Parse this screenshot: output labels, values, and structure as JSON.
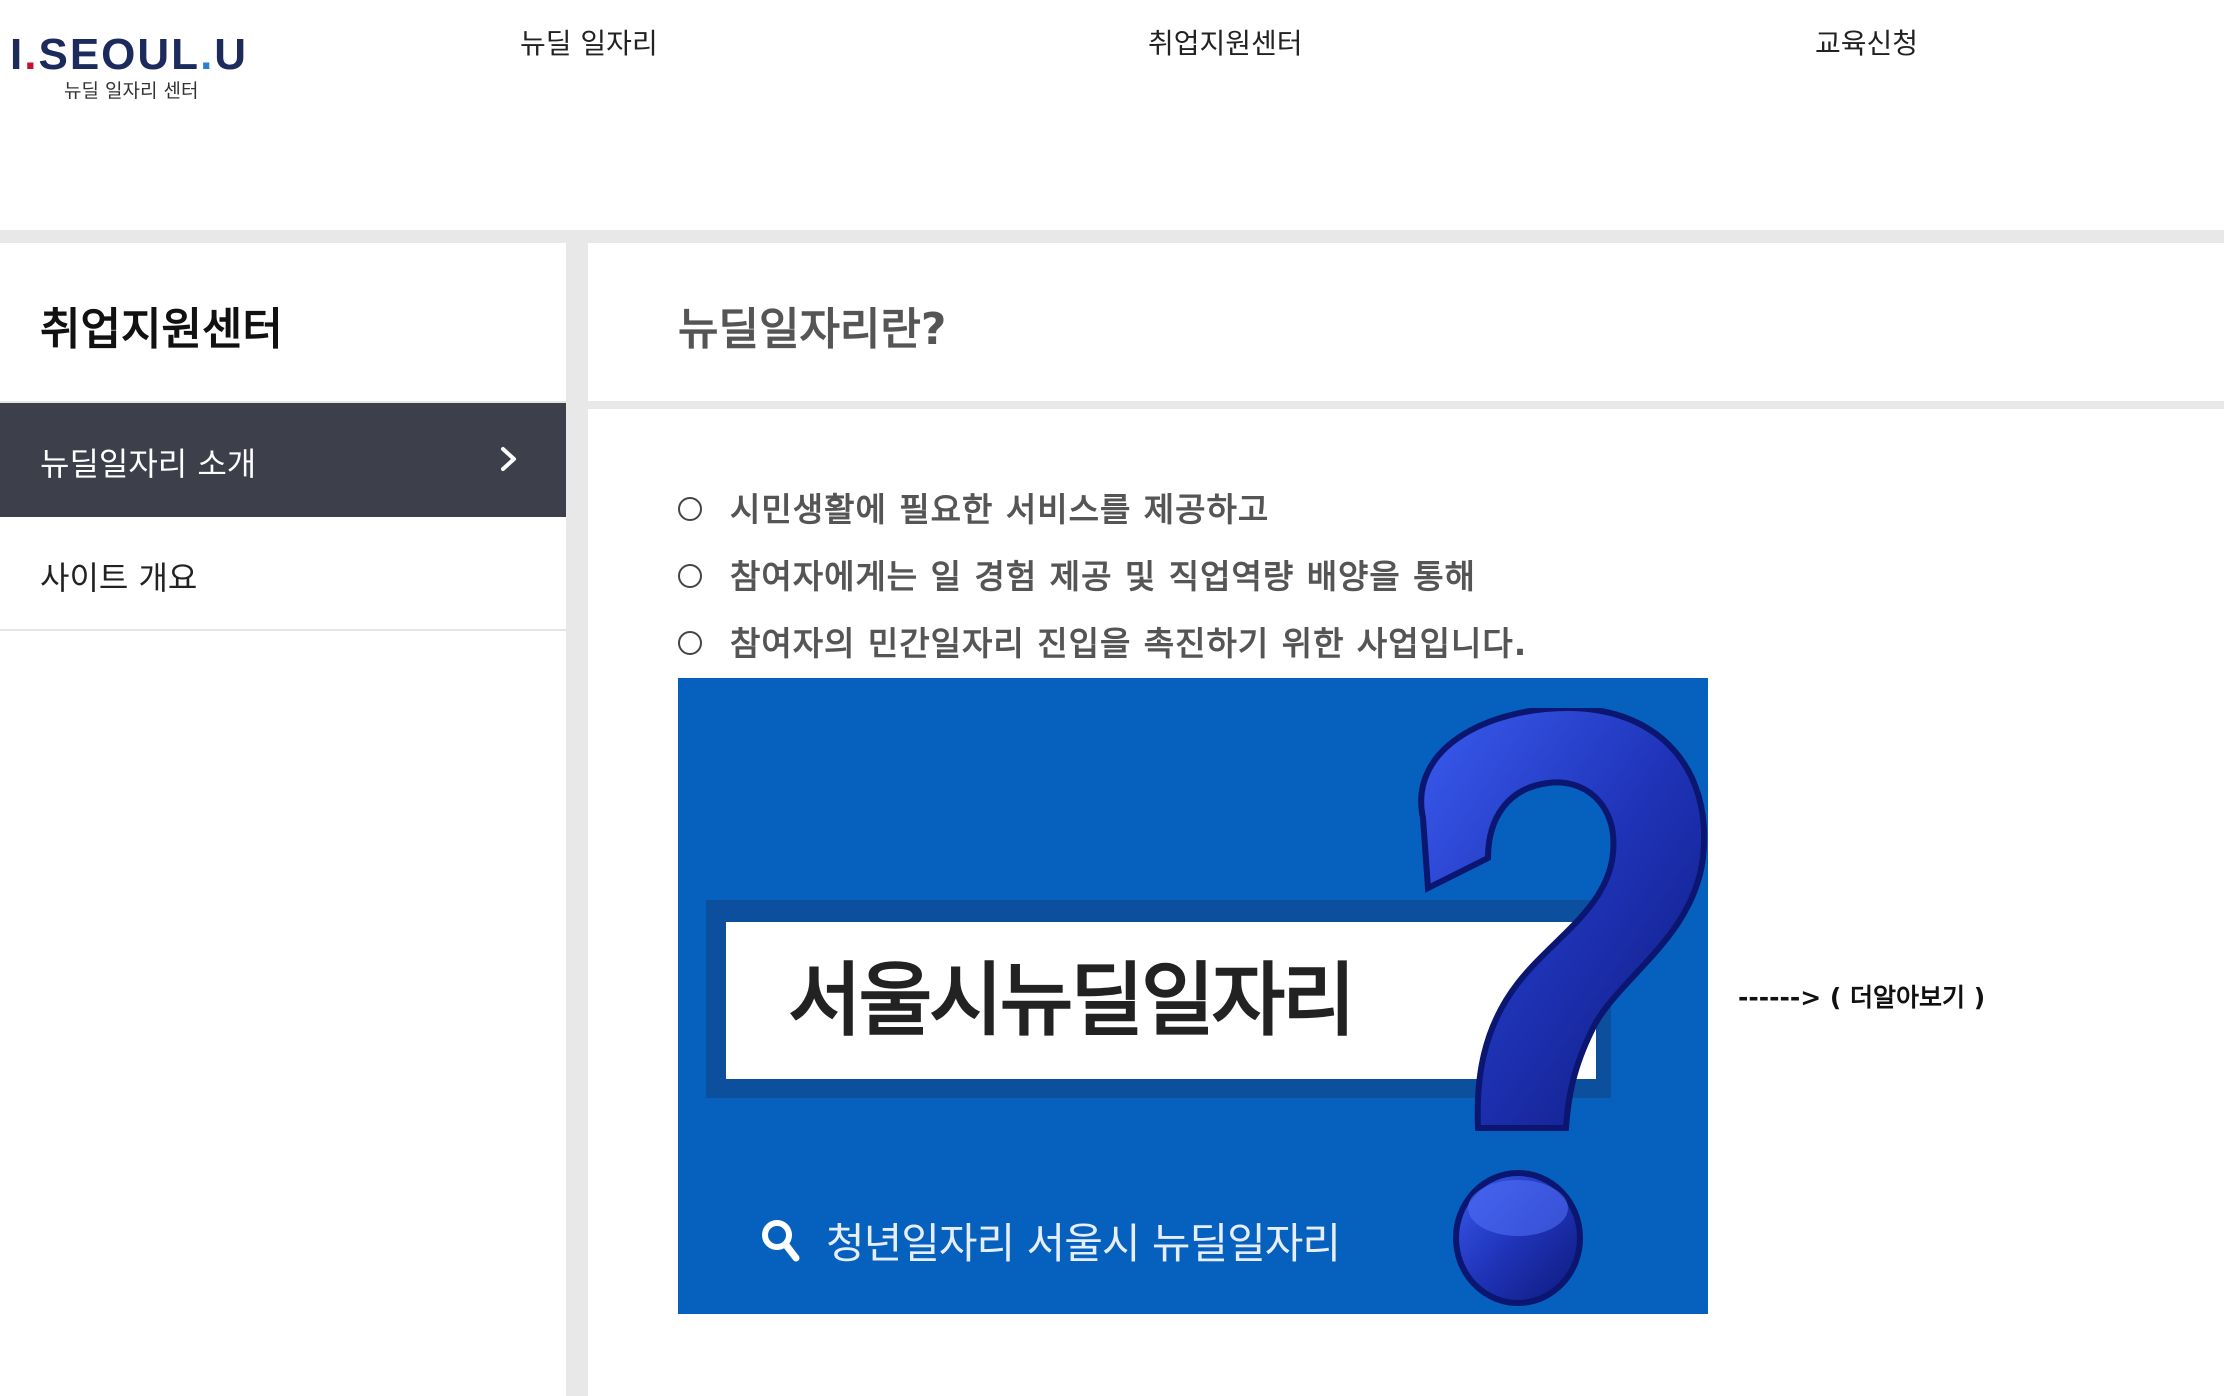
{
  "header": {
    "logo": {
      "main_left": "I",
      "main_mid": "SE",
      "main_o": "O",
      "main_ul": "UL",
      "main_u": "U",
      "sub": "뉴딜 일자리 센터"
    },
    "nav": [
      {
        "label": "뉴딜 일자리"
      },
      {
        "label": "취업지원센터"
      },
      {
        "label": "교육신청"
      }
    ]
  },
  "sidebar": {
    "title": "취업지원센터",
    "items": [
      {
        "label": "뉴딜일자리 소개",
        "active": true
      },
      {
        "label": "사이트 개요",
        "active": false
      }
    ]
  },
  "main": {
    "title": "뉴딜일자리란?",
    "bullets": [
      {
        "text": "시민생활에 필요한 서비스를 제공하고"
      },
      {
        "text": "참여자에게는 일 경험 제공 및 직업역량 배양을 통해"
      },
      {
        "text": "참여자의 민간일자리 진입을 촉진하기 위한 사업입니다."
      }
    ],
    "banner": {
      "heading": "서울시뉴딜일자리",
      "search_text": "청년일자리 서울시 뉴딜일자리"
    },
    "more_link": "------> ( 더알아보기 )"
  },
  "colors": {
    "banner_blue": "#0560be",
    "sidebar_active": "#3d3f4a",
    "logo_navy": "#1c2a5c",
    "logo_red": "#c8102e"
  },
  "icons": [
    "chevron-right-icon",
    "search-icon",
    "question-mark-graphic",
    "bullet-circle-icon"
  ]
}
